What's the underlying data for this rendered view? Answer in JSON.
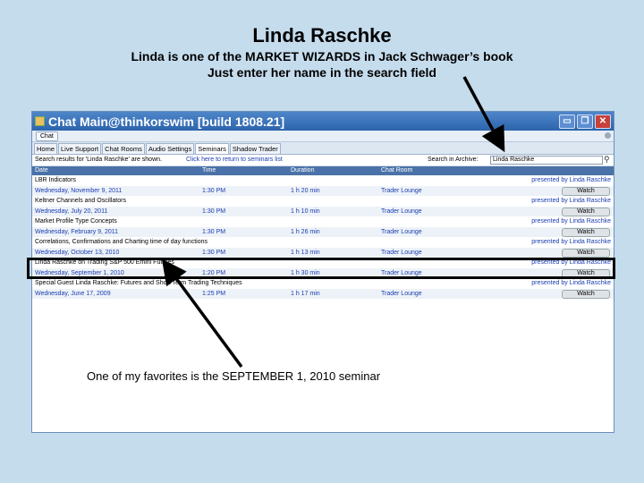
{
  "slide": {
    "title": "Linda Raschke",
    "subtitle1": "Linda is one of the MARKET WIZARDS in Jack Schwager’s book",
    "subtitle2": "Just enter her name in the search field",
    "caption": "One of my favorites is  the SEPTEMBER 1, 2010  seminar"
  },
  "window": {
    "title": "Chat Main@thinkorswim [build 1808.21]",
    "chat_tab": "Chat",
    "buttons": {
      "minimize": "▭",
      "maximize": "❐",
      "close": "✕"
    }
  },
  "tabs": [
    "Home",
    "Live Support",
    "Chat Rooms",
    "Audio Settings",
    "Seminars",
    "Shadow Trader"
  ],
  "search": {
    "results_text": "Search results for 'Linda Raschke' are shown.",
    "return_link": "Click here to return to seminars list",
    "archive_label": "Search in Archive:",
    "query": "Linda Raschke"
  },
  "table": {
    "headers": [
      "Date",
      "Time",
      "Duration",
      "Chat Room"
    ],
    "seminars": [
      {
        "title": "LBR Indicators",
        "presenter": "presented by Linda Raschke",
        "date": "Wednesday, November 9, 2011",
        "time": "1:30 PM",
        "duration": "1 h 20 min",
        "room": "Trader Lounge",
        "watch": "Watch"
      },
      {
        "title": "Keltner Channels and Oscillators",
        "presenter": "presented by Linda Raschke",
        "date": "Wednesday, July 20, 2011",
        "time": "1:30 PM",
        "duration": "1 h 10 min",
        "room": "Trader Lounge",
        "watch": "Watch"
      },
      {
        "title": "Market Profile Type Concepts",
        "presenter": "presented by Linda Raschke",
        "date": "Wednesday, February 9, 2011",
        "time": "1:30 PM",
        "duration": "1 h 26 min",
        "room": "Trader Lounge",
        "watch": "Watch"
      },
      {
        "title": "Correlations, Confirmations and Charting time of day functions",
        "presenter": "presented by Linda Raschke",
        "date": "Wednesday, October 13, 2010",
        "time": "1:30 PM",
        "duration": "1 h 13 min",
        "room": "Trader Lounge",
        "watch": "Watch"
      },
      {
        "title": "Linda Raschke on Trading S&P 500 Emini Futures",
        "presenter": "presented by Linda Raschke",
        "date": "Wednesday, September 1, 2010",
        "time": "1:20 PM",
        "duration": "1 h 30 min",
        "room": "Trader Lounge",
        "watch": "Watch"
      },
      {
        "title": "Special Guest Linda Raschke: Futures and Short Term Trading Techniques",
        "presenter": "presented by Linda Raschke",
        "date": "Wednesday, June 17, 2009",
        "time": "1:25 PM",
        "duration": "1 h 17 min",
        "room": "Trader Lounge",
        "watch": "Watch"
      }
    ]
  }
}
